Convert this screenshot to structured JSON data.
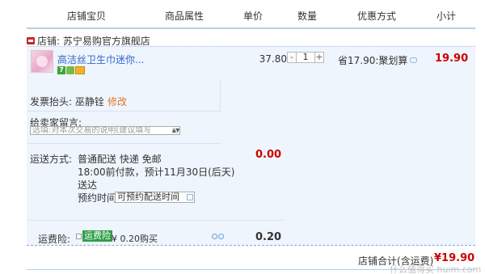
{
  "header": {
    "col_shop_item": "店铺宝贝",
    "col_attrs": "商品属性",
    "col_price": "单价",
    "col_qty": "数量",
    "col_discount": "优惠方式",
    "col_subtotal": "小计"
  },
  "shop": {
    "label": "店铺: 苏宁易购官方旗舰店",
    "icon": "shop-icon"
  },
  "item": {
    "title": "高洁丝卫生巾迷你...",
    "badge_7": "7",
    "price": "37.80",
    "quantity": "1",
    "qty_minus": "-",
    "qty_plus": "+",
    "discount": "省17.90:聚划算",
    "subtotal": "19.90"
  },
  "invoice": {
    "label": "发票抬头: 巫静铨",
    "edit": "修改"
  },
  "message": {
    "label": "给卖家留言:",
    "placeholder": "选填:对本次交易的说明(建议填写",
    "scroll_glyph": "▲▼"
  },
  "shipping": {
    "label": "运送方式:",
    "line1": "普通配送 快递 免邮",
    "line2": "18:00前付款，预计11月30日(后天)",
    "line3": "送达",
    "line4": "预约时间",
    "appointment_value": "可预约配送时间",
    "fee": "0.00"
  },
  "insurance": {
    "label": "运费险:",
    "tag": "运费险",
    "text": "¥ 0.20购买",
    "fee": "0.20"
  },
  "footer": {
    "total_label": "店铺合计(含运费)",
    "total_value": "¥19.90",
    "watermark": "什么值得买 huim.com"
  },
  "colors": {
    "accent_red": "#cc0000",
    "link_blue": "#3366cc",
    "panel_bg": "#eef5fc"
  }
}
